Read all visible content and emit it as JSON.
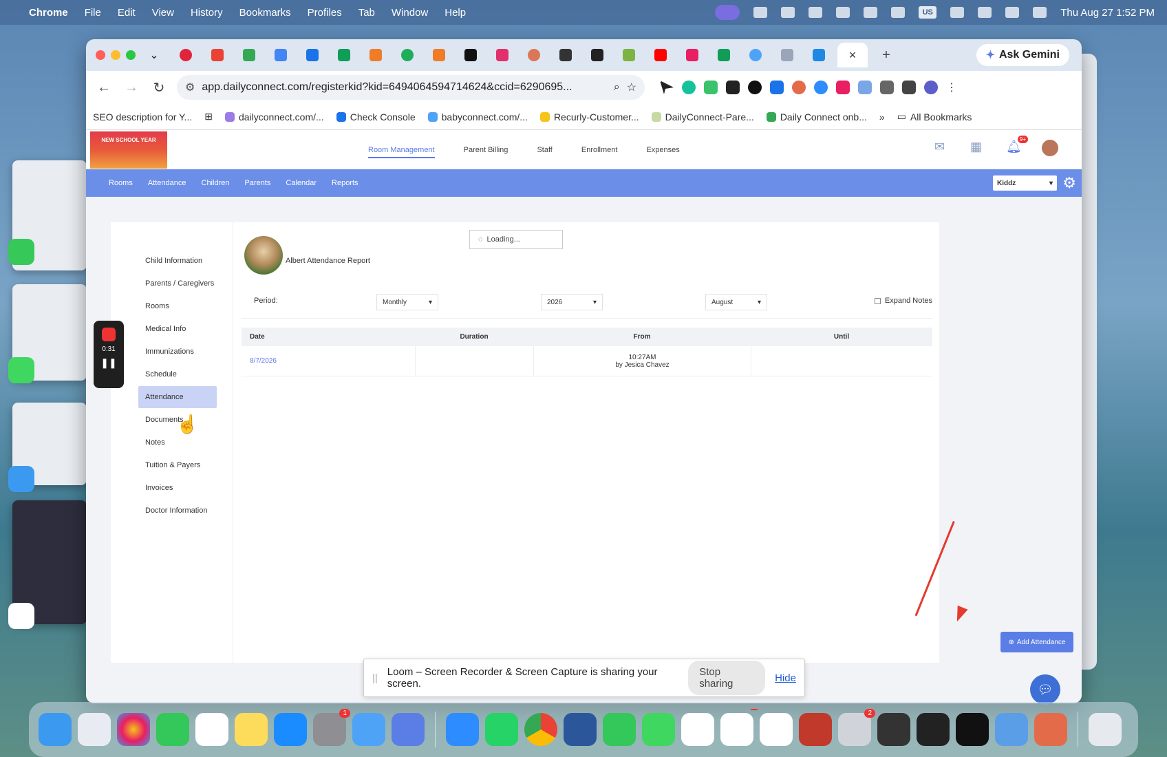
{
  "menubar": {
    "app": "Chrome",
    "items": [
      "File",
      "Edit",
      "View",
      "History",
      "Bookmarks",
      "Profiles",
      "Tab",
      "Window",
      "Help"
    ],
    "input_source": "US",
    "datetime": "Thu Aug 27  1:52 PM"
  },
  "browser": {
    "ask_gemini": "Ask Gemini",
    "close_tab": "×",
    "new_tab": "+",
    "url": "app.dailyconnect.com/registerkid?kid=6494064594714624&ccid=6290695...",
    "bookmarks": [
      "SEO description for Y...",
      "dailyconnect.com/...",
      "Check Console",
      "babyconnect.com/...",
      "Recurly-Customer...",
      "DailyConnect-Pare...",
      "Daily Connect onb..."
    ],
    "bookmarks_more": "»",
    "all_bookmarks": "All Bookmarks"
  },
  "app": {
    "logo_text": "NEW SCHOOL YEAR",
    "top_nav": [
      "Room Management",
      "Parent Billing",
      "Staff",
      "Enrollment",
      "Expenses"
    ],
    "top_nav_active": "Room Management",
    "notification_badge": "9+",
    "sub_nav": [
      "Rooms",
      "Attendance",
      "Children",
      "Parents",
      "Calendar",
      "Reports"
    ],
    "org_select": "Kiddz",
    "left_menu": [
      "Child Information",
      "Parents / Caregivers",
      "Rooms",
      "Medical Info",
      "Immunizations",
      "Schedule",
      "Attendance",
      "Documents",
      "Notes",
      "Tuition & Payers",
      "Invoices",
      "Doctor Information"
    ],
    "left_menu_active": "Attendance",
    "loading_text": "Loading...",
    "report_title": "Albert Attendance Report",
    "filters": {
      "period_label": "Period:",
      "period_value": "Monthly",
      "year_value": "2026",
      "month_value": "August",
      "expand_notes": "Expand Notes"
    },
    "table": {
      "headers": [
        "Date",
        "Duration",
        "From",
        "Until"
      ],
      "rows": [
        {
          "date": "8/7/2026",
          "duration": "",
          "from_time": "10:27AM",
          "from_by": "by Jesica Chavez",
          "until": ""
        }
      ]
    },
    "add_attendance": "Add Attendance"
  },
  "loom": {
    "timer": "0:31",
    "message": "Loom – Screen Recorder & Screen Capture is sharing your screen.",
    "stop_sharing": "Stop sharing",
    "hide": "Hide"
  },
  "dock": {
    "badges": {
      "settings": "1",
      "slack": "",
      "printer": "2"
    }
  }
}
